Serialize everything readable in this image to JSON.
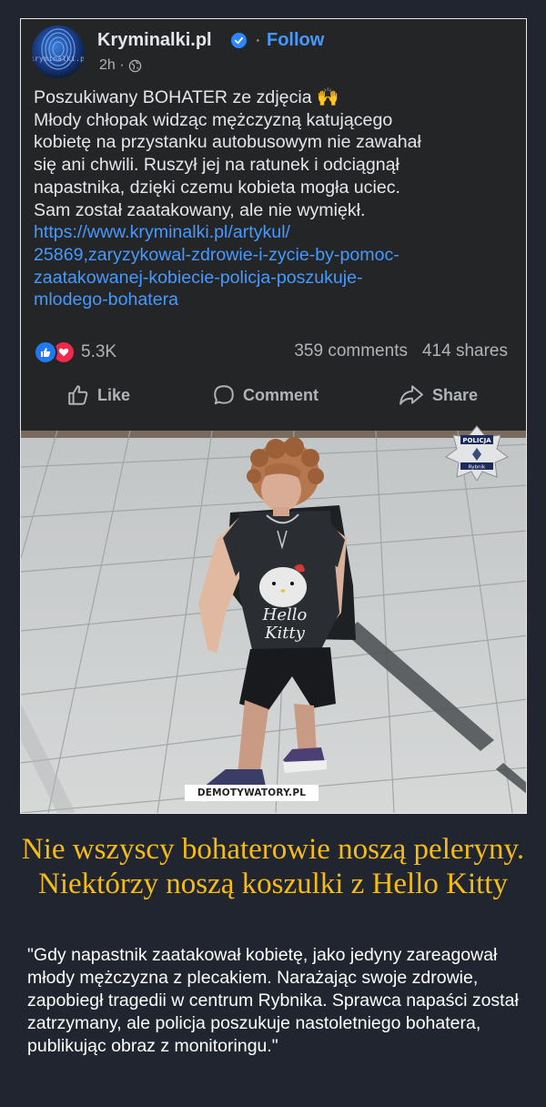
{
  "post": {
    "page_name": "Kryminalki.pl",
    "avatar_text": "kryminalki.pl",
    "separator": "·",
    "follow_label": "Follow",
    "time": "2h ·",
    "audience_icon": "globe-icon",
    "text_lines": [
      "Poszukiwany BOHATER ze zdjęcia 🙌",
      "Młody chłopak widząc mężczyzną katującego",
      "kobietę na przystanku autobusowym nie zawahał",
      "się ani chwili. Ruszył jej na ratunek i odciągnął",
      "napastnika, dzięki czemu kobieta mogła uciec.",
      "Sam został zaatakowany, ale nie wymiękł."
    ],
    "link_lines": [
      "https://www.kryminalki.pl/artykul/",
      "25869,zaryzykowal-zdrowie-i-zycie-by-pomoc-",
      "zaatakowanej-kobiecie-policja-poszukuje-",
      "mlodego-bohatera"
    ],
    "reactions_count": "5.3K",
    "comments": "359 comments",
    "shares": "414 shares",
    "actions": {
      "like": "Like",
      "comment": "Comment",
      "share": "Share"
    }
  },
  "photo": {
    "shirt_text_1": "Hello",
    "shirt_text_2": "Kitty",
    "badge_text": "POLICJA",
    "badge_subtext": "Rybnik",
    "watermark": "DEMOTYWATORY.PL"
  },
  "headline": "Nie wszyscy bohaterowie noszą peleryny. Niektórzy noszą koszulki z Hello Kitty",
  "caption": "\"Gdy napastnik zaatakował kobietę, jako jedyny zareagował młody mężczyzna z plecakiem. Narażając swoje zdrowie, zapobiegł tragedii w centrum Rybnika. Sprawca napaści został zatrzymany, ale policja poszukuje nastoletniego bohatera, publikując obraz z monitoringu.\"",
  "colors": {
    "background": "#21252f",
    "headline": "#f5bc16",
    "link": "#4599ff",
    "card": "#242526"
  }
}
